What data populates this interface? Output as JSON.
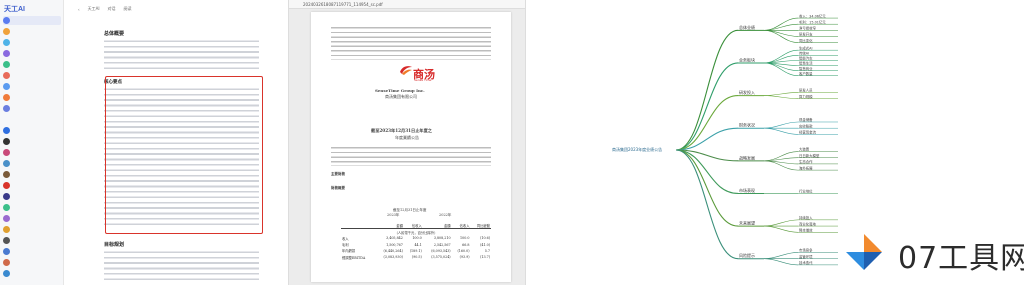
{
  "app": {
    "logo": "天工AI"
  },
  "chat": {
    "toolbar": {
      "title": "天工AI",
      "tabs": [
        "对话",
        "阅读"
      ]
    },
    "sections": [
      "总体概要",
      "核心要点",
      "总结要点",
      "目标规划"
    ]
  },
  "pdf": {
    "filename": "2024032618087119771_114954_sc.pdf",
    "brand_en": "Sense Time",
    "company_en": "SenseTime Group Inc.",
    "company_cn": "商汤集团有限公司",
    "report_title": "截至2023年12月31日止年度之",
    "report_subtitle": "年度業績公告",
    "section_1": "主要財務",
    "section_2": "財務概要",
    "table_title": "截至12月31日止年度",
    "table_year_1": "2023年",
    "table_year_2": "2022年",
    "table_header": [
      "",
      "金額",
      "佔收入",
      "金額",
      "佔收入",
      "同比變動"
    ],
    "table_unit": "（人民幣千元，百分比除外）",
    "table_rows": [
      [
        "收入",
        "3,405,842",
        "100.0",
        "3,808,210",
        "100.0",
        "(10.6)"
      ],
      [
        "毛利",
        "1,500,767",
        "44.1",
        "2,542,567",
        "66.8",
        "(41.0)"
      ],
      [
        "年內虧損",
        "(6,440,264)",
        "(189.1)",
        "(6,093,543)",
        "(160.0)",
        "5.7"
      ],
      [
        "經調整EBITDA",
        "(3,083,930)",
        "(90.5)",
        "(3,575,024)",
        "(93.9)",
        "(13.7)"
      ]
    ]
  },
  "mindmap": {
    "root": "商汤集团2023年度业绩公告",
    "branches": [
      {
        "label": "总体业绩",
        "leaves": [
          "收入：34.06亿元",
          "毛利：15.01亿元",
          "净亏损收窄",
          "研发开支",
          "同比变化"
        ]
      },
      {
        "label": "业务板块",
        "leaves": [
          "生成式AI",
          "传统AI",
          "智能汽车",
          "智慧生活",
          "智慧商业",
          "客户数量"
        ]
      },
      {
        "label": "研发投入",
        "leaves": [
          "研发人员",
          "算力规模"
        ]
      },
      {
        "label": "财务状况",
        "leaves": [
          "现金储备",
          "应收账款",
          "经营现金流"
        ]
      },
      {
        "label": "战略发展",
        "leaves": [
          "大装置",
          "日日新大模型",
          "生态合作",
          "海外拓展"
        ]
      },
      {
        "label": "市场表现",
        "leaves": [
          "行业地位"
        ]
      },
      {
        "label": "未来展望",
        "leaves": [
          "持续投入",
          "商业化落地",
          "降本增效"
        ]
      },
      {
        "label": "风险提示",
        "leaves": [
          "市场竞争",
          "监管环境",
          "技术迭代"
        ]
      }
    ]
  },
  "watermark": {
    "text": "07工具网"
  }
}
